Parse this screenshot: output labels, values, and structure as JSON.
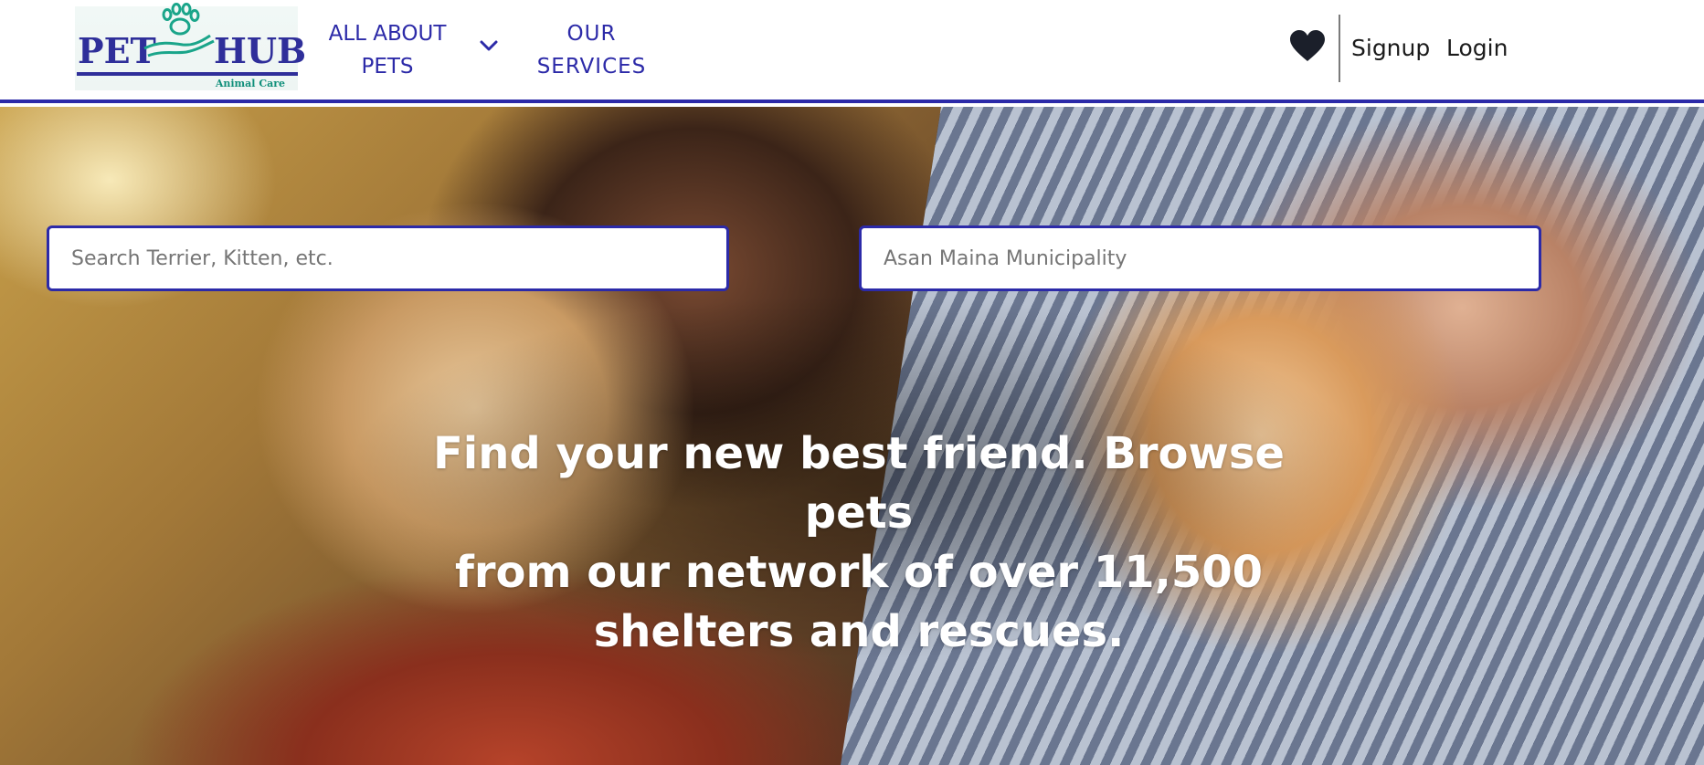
{
  "logo": {
    "word_left": "PET",
    "word_right": "HUB",
    "tagline": "Animal Care",
    "icon": "paw-hand-icon"
  },
  "nav": {
    "about_line1": "ALL ABOUT",
    "about_line2": "PETS",
    "about_dropdown_icon": "chevron-down-icon",
    "services_line1": "OUR",
    "services_line2": "SERVICES"
  },
  "header_actions": {
    "favorites_icon": "heart-icon",
    "signup_label": "Signup",
    "login_label": "Login"
  },
  "search": {
    "pet_placeholder": "Search Terrier, Kitten, etc.",
    "location_placeholder": "Asan Maina Municipality"
  },
  "hero": {
    "headline_line1": "Find your new best friend. Browse pets",
    "headline_line2": "from our network of over 11,500",
    "headline_line3": "shelters and rescues.",
    "image_description": "dog-and-cat-photo"
  },
  "colors": {
    "brand": "#2c2aa8",
    "logo_accent": "#0f8f7a",
    "text_dark": "#1b1b1b"
  }
}
